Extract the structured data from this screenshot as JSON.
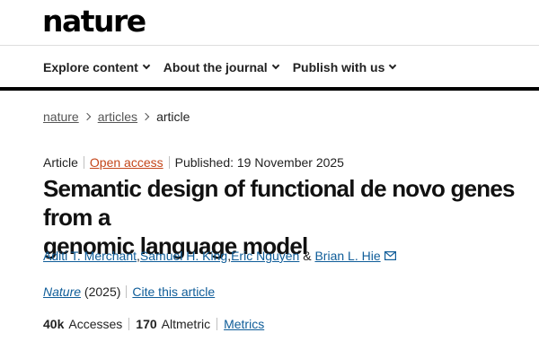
{
  "header": {
    "logo": "nature"
  },
  "nav": {
    "items": [
      {
        "label": "Explore content"
      },
      {
        "label": "About the journal"
      },
      {
        "label": "Publish with us"
      }
    ]
  },
  "breadcrumb": {
    "items": [
      "nature",
      "articles",
      "article"
    ]
  },
  "article": {
    "type": "Article",
    "access": "Open access",
    "published": "Published: 19 November 2025",
    "title_line1": "Semantic design of functional de novo genes from a",
    "title_line2": "genomic language model",
    "authors": [
      "Aditi T. Merchant",
      "Samuel H. King",
      "Eric Nguyen",
      "Brian L. Hie"
    ],
    "author_sep": ", ",
    "author_and": " & ",
    "journal": "Nature",
    "year": " (2025)",
    "cite_label": "Cite this article"
  },
  "metrics": {
    "accesses_value": "40k",
    "accesses_label": "Accesses",
    "altmetric_value": "170",
    "altmetric_label": "Altmetric",
    "metrics_label": "Metrics"
  },
  "colors": {
    "link": "#0f5d99",
    "open_access": "#c4461a",
    "rule": "#000000"
  },
  "icons": [
    "chevron-down-icon",
    "chevron-right-icon",
    "mail-icon"
  ]
}
